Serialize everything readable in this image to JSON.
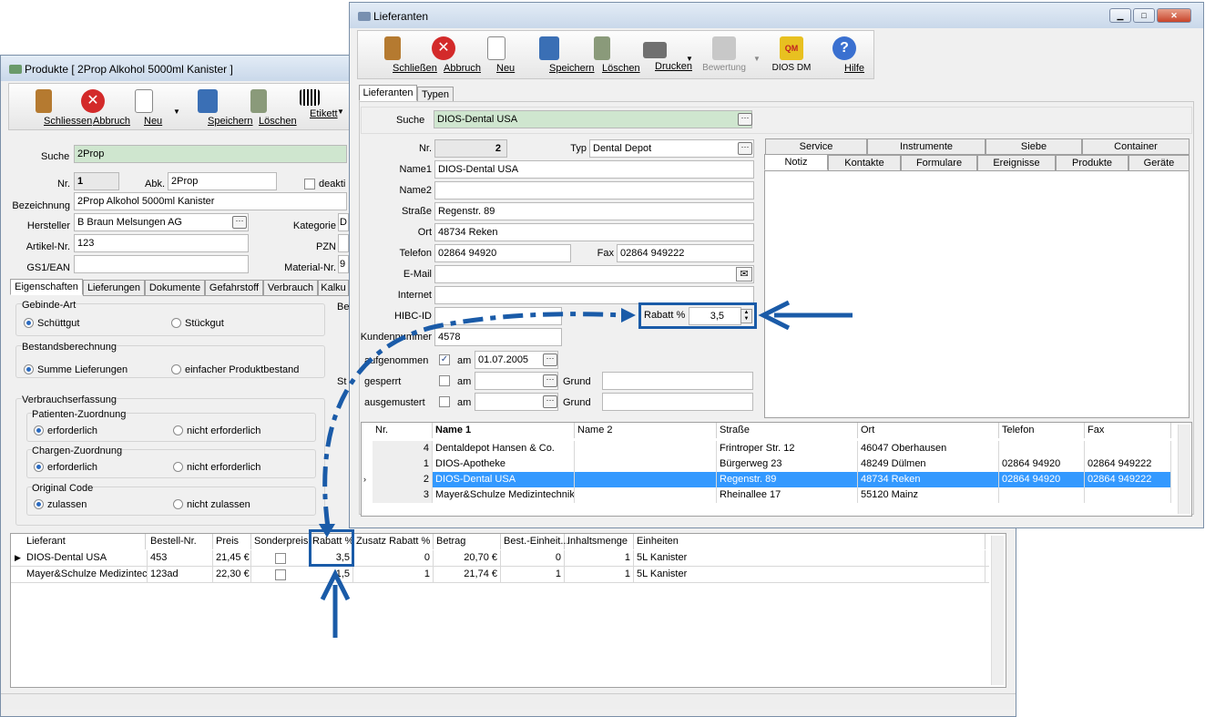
{
  "produkte": {
    "title": "Produkte [ 2Prop Alkohol 5000ml Kanister ]",
    "toolbar": [
      "Schliessen",
      "Abbruch",
      "Neu",
      "Speichern",
      "Löschen",
      "Etikett"
    ],
    "suche_label": "Suche",
    "suche_value": "2Prop",
    "nr_label": "Nr.",
    "nr_value": "1",
    "abk_label": "Abk.",
    "abk_value": "2Prop",
    "deakt_label": "deakti",
    "bez_label": "Bezeichnung",
    "bez_value": "2Prop Alkohol 5000ml Kanister",
    "hersteller_label": "Hersteller",
    "hersteller_value": "B Braun Melsungen AG",
    "kategorie_label": "Kategorie",
    "kategorie_value": "D",
    "artikel_label": "Artikel-Nr.",
    "artikel_value": "123",
    "pzn_label": "PZN",
    "gs1_label": "GS1/EAN",
    "material_label": "Material-Nr.",
    "material_value": "9",
    "tabs": [
      "Eigenschaften",
      "Lieferungen",
      "Dokumente",
      "Gefahrstoff",
      "Verbrauch",
      "Kalku"
    ],
    "side_labels": [
      "Be",
      "St"
    ],
    "gebinde": {
      "title": "Gebinde-Art",
      "opt1": "Schüttgut",
      "opt2": "Stückgut"
    },
    "bestand": {
      "title": "Bestandsberechnung",
      "opt1": "Summe Lieferungen",
      "opt2": "einfacher Produktbestand"
    },
    "verbrauch": {
      "title": "Verbrauchserfassung",
      "patient": {
        "title": "Patienten-Zuordnung",
        "opt1": "erforderlich",
        "opt2": "nicht erforderlich"
      },
      "charge": {
        "title": "Chargen-Zuordnung",
        "opt1": "erforderlich",
        "opt2": "nicht erforderlich"
      },
      "code": {
        "title": "Original Code",
        "opt1": "zulassen",
        "opt2": "nicht zulassen"
      }
    },
    "grid": {
      "headers": [
        "Lieferant",
        "Bestell-Nr.",
        "Preis",
        "Sonderpreis",
        "Rabatt %",
        "Zusatz Rabatt %",
        "Betrag",
        "Best.-Einheit...",
        "Inhaltsmenge",
        "Einheiten"
      ],
      "rows": [
        [
          "DIOS-Dental USA",
          "453",
          "21,45 €",
          "",
          "3,5",
          "0",
          "20,70 €",
          "0",
          "1",
          "5L Kanister"
        ],
        [
          "Mayer&Schulze Medizintech",
          "123ad",
          "22,30 €",
          "",
          "1,5",
          "1",
          "21,74 €",
          "1",
          "1",
          "5L Kanister"
        ]
      ]
    }
  },
  "lieferanten": {
    "title": "Lieferanten",
    "toolbar": [
      "Schließen",
      "Abbruch",
      "Neu",
      "Speichern",
      "Löschen",
      "Drucken",
      "Bewertung",
      "DIOS DM",
      "Hilfe"
    ],
    "tabs": [
      "Lieferanten",
      "Typen"
    ],
    "suche_label": "Suche",
    "suche_value": "DIOS-Dental USA",
    "nr_label": "Nr.",
    "nr_value": "2",
    "typ_label": "Typ",
    "typ_value": "Dental Depot",
    "name1_label": "Name1",
    "name1_value": "DIOS-Dental USA",
    "name2_label": "Name2",
    "name2_value": "",
    "strasse_label": "Straße",
    "strasse_value": "Regenstr. 89",
    "ort_label": "Ort",
    "ort_value": "48734 Reken",
    "telefon_label": "Telefon",
    "telefon_value": "02864 94920",
    "fax_label": "Fax",
    "fax_value": "02864 949222",
    "email_label": "E-Mail",
    "internet_label": "Internet",
    "hibc_label": "HIBC-ID",
    "rabatt_label": "Rabatt %",
    "rabatt_value": "3,5",
    "kunden_label": "Kundennummer",
    "kunden_value": "4578",
    "aufgenommen_label": "aufgenommen",
    "am_label": "am",
    "aufgenommen_date": "01.07.2005",
    "gesperrt_label": "gesperrt",
    "ausgemustert_label": "ausgemustert",
    "grund_label": "Grund",
    "right_tabs_row1": [
      "Service",
      "Instrumente",
      "Siebe",
      "Container"
    ],
    "right_tabs_row2": [
      "Notiz",
      "Kontakte",
      "Formulare",
      "Ereignisse",
      "Produkte",
      "Geräte"
    ],
    "grid": {
      "headers": [
        "Nr.",
        "Name 1",
        "Name 2",
        "Straße",
        "Ort",
        "Telefon",
        "Fax"
      ],
      "rows": [
        [
          "4",
          "Dentaldepot Hansen & Co.",
          "",
          "Frintroper Str. 12",
          "46047 Oberhausen",
          "",
          ""
        ],
        [
          "1",
          "DIOS-Apotheke",
          "",
          "Bürgerweg 23",
          "48249 Dülmen",
          "02864 94920",
          "02864 949222"
        ],
        [
          "2",
          "DIOS-Dental USA",
          "",
          "Regenstr. 89",
          "48734 Reken",
          "02864 94920",
          "02864 949222"
        ],
        [
          "3",
          "Mayer&Schulze Medizintechnik",
          "",
          "Rheinallee 17",
          "55120 Mainz",
          "",
          ""
        ]
      ]
    }
  },
  "colors": {
    "arrow": "#1a5ba8",
    "selection": "#3399ff",
    "search_bg": "#cfe6cf"
  }
}
